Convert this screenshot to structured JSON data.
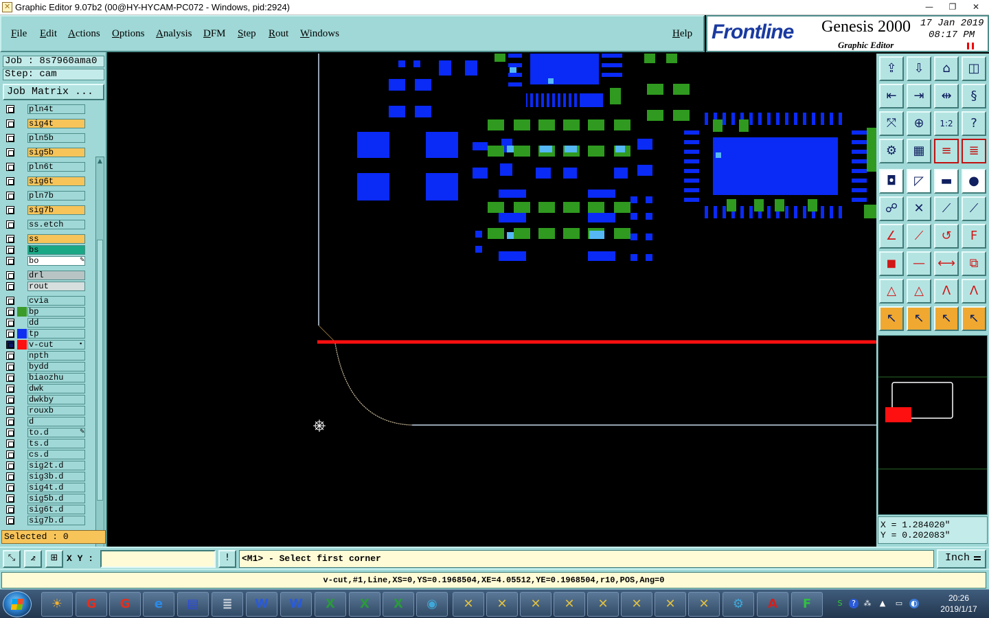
{
  "window": {
    "title": "Graphic Editor 9.07b2 (00@HY-HYCAM-PC072 - Windows, pid:2924)",
    "minimize": "—",
    "maximize": "❐",
    "close": "✕"
  },
  "menubar": {
    "items": [
      "File",
      "Edit",
      "Actions",
      "Options",
      "Analysis",
      "DFM",
      "Step",
      "Rout",
      "Windows"
    ],
    "help": "Help"
  },
  "logo": {
    "frontline": "Frontline",
    "product": "Genesis 2000",
    "subtitle": "Graphic Editor",
    "date": "17 Jan 2019",
    "time": "08:17 PM"
  },
  "left_panel": {
    "job": "Job : 8s7960ama0",
    "step": "Step: cam",
    "job_matrix": "Job Matrix ...",
    "selected": "Selected : 0",
    "layers": [
      {
        "name": "pln4t",
        "bg": "#9fd8d6",
        "swatch": ""
      },
      {
        "name": "sig4t",
        "bg": "#f7c45a",
        "swatch": ""
      },
      {
        "name": "pln5b",
        "bg": "#9fd8d6",
        "swatch": ""
      },
      {
        "name": "sig5b",
        "bg": "#f7c45a",
        "swatch": ""
      },
      {
        "name": "pln6t",
        "bg": "#9fd8d6",
        "swatch": ""
      },
      {
        "name": "sig6t",
        "bg": "#f7c45a",
        "swatch": ""
      },
      {
        "name": "pln7b",
        "bg": "#9fd8d6",
        "swatch": ""
      },
      {
        "name": "sig7b",
        "bg": "#f7c45a",
        "swatch": ""
      },
      {
        "name": "ss.etch",
        "bg": "#9fd8d6",
        "swatch": ""
      },
      {
        "name": "ss",
        "bg": "#f7c45a",
        "swatch": ""
      },
      {
        "name": "bs",
        "bg": "#1aa886",
        "swatch": ""
      },
      {
        "name": "bo",
        "bg": "#ffffff",
        "swatch": "",
        "mark": "✎"
      },
      {
        "name": "drl",
        "bg": "#b8c4c4",
        "swatch": ""
      },
      {
        "name": "rout",
        "bg": "#d6dede",
        "swatch": ""
      },
      {
        "name": "cvia",
        "bg": "#9fd8d6",
        "swatch": ""
      },
      {
        "name": "bp",
        "bg": "#9fd8d6",
        "swatch": "#3a9a2a"
      },
      {
        "name": "dd",
        "bg": "#9fd8d6",
        "swatch": ""
      },
      {
        "name": "tp",
        "bg": "#9fd8d6",
        "swatch": "#1030f0"
      },
      {
        "name": "v-cut",
        "bg": "#9fd8d6",
        "swatch": "#ff1010",
        "mark": "▪",
        "active": true
      },
      {
        "name": "npth",
        "bg": "#9fd8d6",
        "swatch": ""
      },
      {
        "name": "bydd",
        "bg": "#9fd8d6",
        "swatch": ""
      },
      {
        "name": "biaozhu",
        "bg": "#9fd8d6",
        "swatch": ""
      },
      {
        "name": "dwk",
        "bg": "#9fd8d6",
        "swatch": ""
      },
      {
        "name": "dwkby",
        "bg": "#9fd8d6",
        "swatch": ""
      },
      {
        "name": "rouxb",
        "bg": "#9fd8d6",
        "swatch": ""
      },
      {
        "name": "d",
        "bg": "#9fd8d6",
        "swatch": ""
      },
      {
        "name": "to.d",
        "bg": "#9fd8d6",
        "swatch": "",
        "mark": "✎"
      },
      {
        "name": "ts.d",
        "bg": "#9fd8d6",
        "swatch": ""
      },
      {
        "name": "cs.d",
        "bg": "#9fd8d6",
        "swatch": ""
      },
      {
        "name": "sig2t.d",
        "bg": "#9fd8d6",
        "swatch": ""
      },
      {
        "name": "sig3b.d",
        "bg": "#9fd8d6",
        "swatch": ""
      },
      {
        "name": "sig4t.d",
        "bg": "#9fd8d6",
        "swatch": ""
      },
      {
        "name": "sig5b.d",
        "bg": "#9fd8d6",
        "swatch": ""
      },
      {
        "name": "sig6t.d",
        "bg": "#9fd8d6",
        "swatch": ""
      },
      {
        "name": "sig7b.d",
        "bg": "#9fd8d6",
        "swatch": ""
      }
    ]
  },
  "right_panel": {
    "coords_x": "X = 1.284020\"",
    "coords_y": "Y = 0.202083\""
  },
  "command_bar": {
    "xy_label": "X Y :",
    "xy_value": "",
    "prompt": "<M1> - Select first corner",
    "unit": "Inch"
  },
  "status_line": "v-cut,#1,Line,XS=0,YS=0.1968504,XE=4.05512,YE=0.1968504,r10,POS,Ang=0",
  "taskbar": {
    "clock_time": "20:26",
    "clock_date": "2019/1/17"
  },
  "colors": {
    "panel": "#9fd8d6",
    "highlight": "#f7c45a",
    "pad_blue": "#0a2af5",
    "pad_green": "#2f9a1f",
    "vcut_red": "#ff1010"
  }
}
